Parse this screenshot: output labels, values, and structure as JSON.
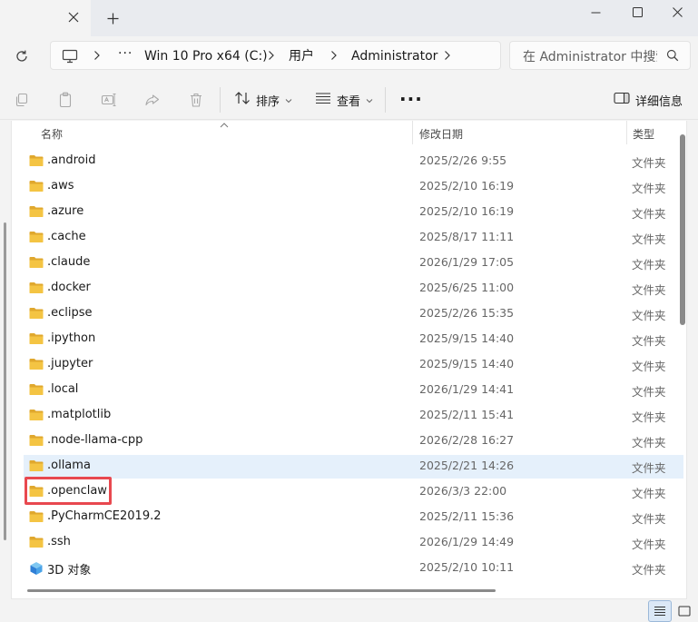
{
  "window": {
    "tab_close_icon": "close-icon",
    "new_tab_icon": "plus-icon"
  },
  "address": {
    "crumbs": [
      "Win 10 Pro x64 (C:)",
      "用户",
      "Administrator"
    ],
    "overflow": "···",
    "search_placeholder": "在 Administrator 中搜索"
  },
  "toolbar": {
    "sort_label": "排序",
    "view_label": "查看",
    "more_label": "···",
    "details_label": "详细信息"
  },
  "columns": {
    "name": "名称",
    "modified": "修改日期",
    "type": "类型"
  },
  "files": [
    {
      "name": ".android",
      "date": "2025/2/26 9:55",
      "type": "文件夹",
      "icon": "folder-icon"
    },
    {
      "name": ".aws",
      "date": "2025/2/10 16:19",
      "type": "文件夹",
      "icon": "folder-icon"
    },
    {
      "name": ".azure",
      "date": "2025/2/10 16:19",
      "type": "文件夹",
      "icon": "folder-icon"
    },
    {
      "name": ".cache",
      "date": "2025/8/17 11:11",
      "type": "文件夹",
      "icon": "folder-icon"
    },
    {
      "name": ".claude",
      "date": "2026/1/29 17:05",
      "type": "文件夹",
      "icon": "folder-icon"
    },
    {
      "name": ".docker",
      "date": "2025/6/25 11:00",
      "type": "文件夹",
      "icon": "folder-icon"
    },
    {
      "name": ".eclipse",
      "date": "2025/2/26 15:35",
      "type": "文件夹",
      "icon": "folder-icon"
    },
    {
      "name": ".ipython",
      "date": "2025/9/15 14:40",
      "type": "文件夹",
      "icon": "folder-icon"
    },
    {
      "name": ".jupyter",
      "date": "2025/9/15 14:40",
      "type": "文件夹",
      "icon": "folder-icon"
    },
    {
      "name": ".local",
      "date": "2026/1/29 14:41",
      "type": "文件夹",
      "icon": "folder-icon"
    },
    {
      "name": ".matplotlib",
      "date": "2025/2/11 15:41",
      "type": "文件夹",
      "icon": "folder-icon"
    },
    {
      "name": ".node-llama-cpp",
      "date": "2026/2/28 16:27",
      "type": "文件夹",
      "icon": "folder-icon"
    },
    {
      "name": ".ollama",
      "date": "2025/2/21 14:26",
      "type": "文件夹",
      "icon": "folder-icon",
      "selected": true
    },
    {
      "name": ".openclaw",
      "date": "2026/3/3 22:00",
      "type": "文件夹",
      "icon": "folder-icon",
      "highlighted": true
    },
    {
      "name": ".PyCharmCE2019.2",
      "date": "2025/2/11 15:36",
      "type": "文件夹",
      "icon": "folder-icon"
    },
    {
      "name": ".ssh",
      "date": "2026/1/29 14:49",
      "type": "文件夹",
      "icon": "folder-icon"
    },
    {
      "name": "3D 对象",
      "date": "2025/2/10 10:11",
      "type": "文件夹",
      "icon": "3d-objects-icon"
    }
  ],
  "colors": {
    "folder": "#f4c443",
    "folder_dark": "#e0a82e",
    "selection": "#e5f0fb",
    "highlight_border": "#e8484f"
  }
}
